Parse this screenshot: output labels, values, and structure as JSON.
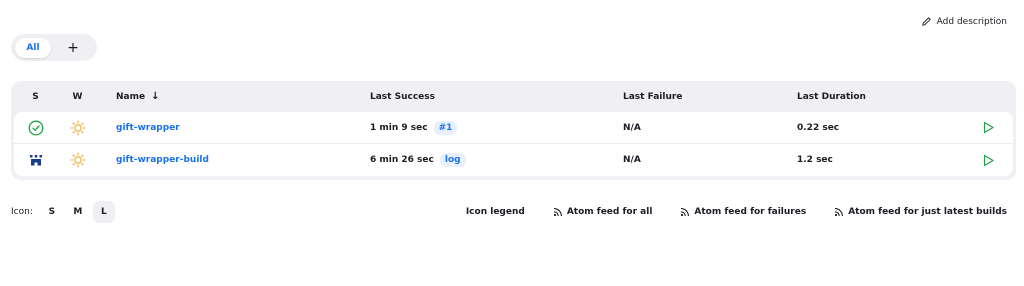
{
  "header": {
    "add_description_label": "Add description",
    "add_description_icon": "pencil-icon"
  },
  "tabs": [
    {
      "label": "All",
      "active": true
    },
    {
      "label": "+",
      "active": false
    }
  ],
  "table": {
    "columns": {
      "s": "S",
      "w": "W",
      "name": "Name",
      "name_sort": "↓",
      "last_success": "Last Success",
      "last_failure": "Last Failure",
      "last_duration": "Last Duration"
    },
    "rows": [
      {
        "status_icon": "success-check-icon",
        "weather_icon": "sunny-icon",
        "name": "gift-wrapper",
        "last_success": "1 min 9 sec",
        "success_badge": "#1",
        "last_failure": "N/A",
        "last_duration": "0.22 sec",
        "run_icon": "play-icon"
      },
      {
        "status_icon": "not-built-icon",
        "weather_icon": "sunny-icon",
        "name": "gift-wrapper-build",
        "last_success": "6 min 26 sec",
        "success_badge": "log",
        "last_failure": "N/A",
        "last_duration": "1.2 sec",
        "run_icon": "play-icon"
      }
    ]
  },
  "footer": {
    "icon_label": "Icon:",
    "sizes": [
      "S",
      "M",
      "L"
    ],
    "active_size": "L",
    "icon_legend": "Icon legend",
    "feed_all": "Atom feed for all",
    "feed_failures": "Atom feed for failures",
    "feed_latest": "Atom feed for just latest builds"
  },
  "colors": {
    "accent": "#1a73e8",
    "success": "#1ea446",
    "sun": "#f5a623",
    "not_built": "#1a3a8a"
  }
}
